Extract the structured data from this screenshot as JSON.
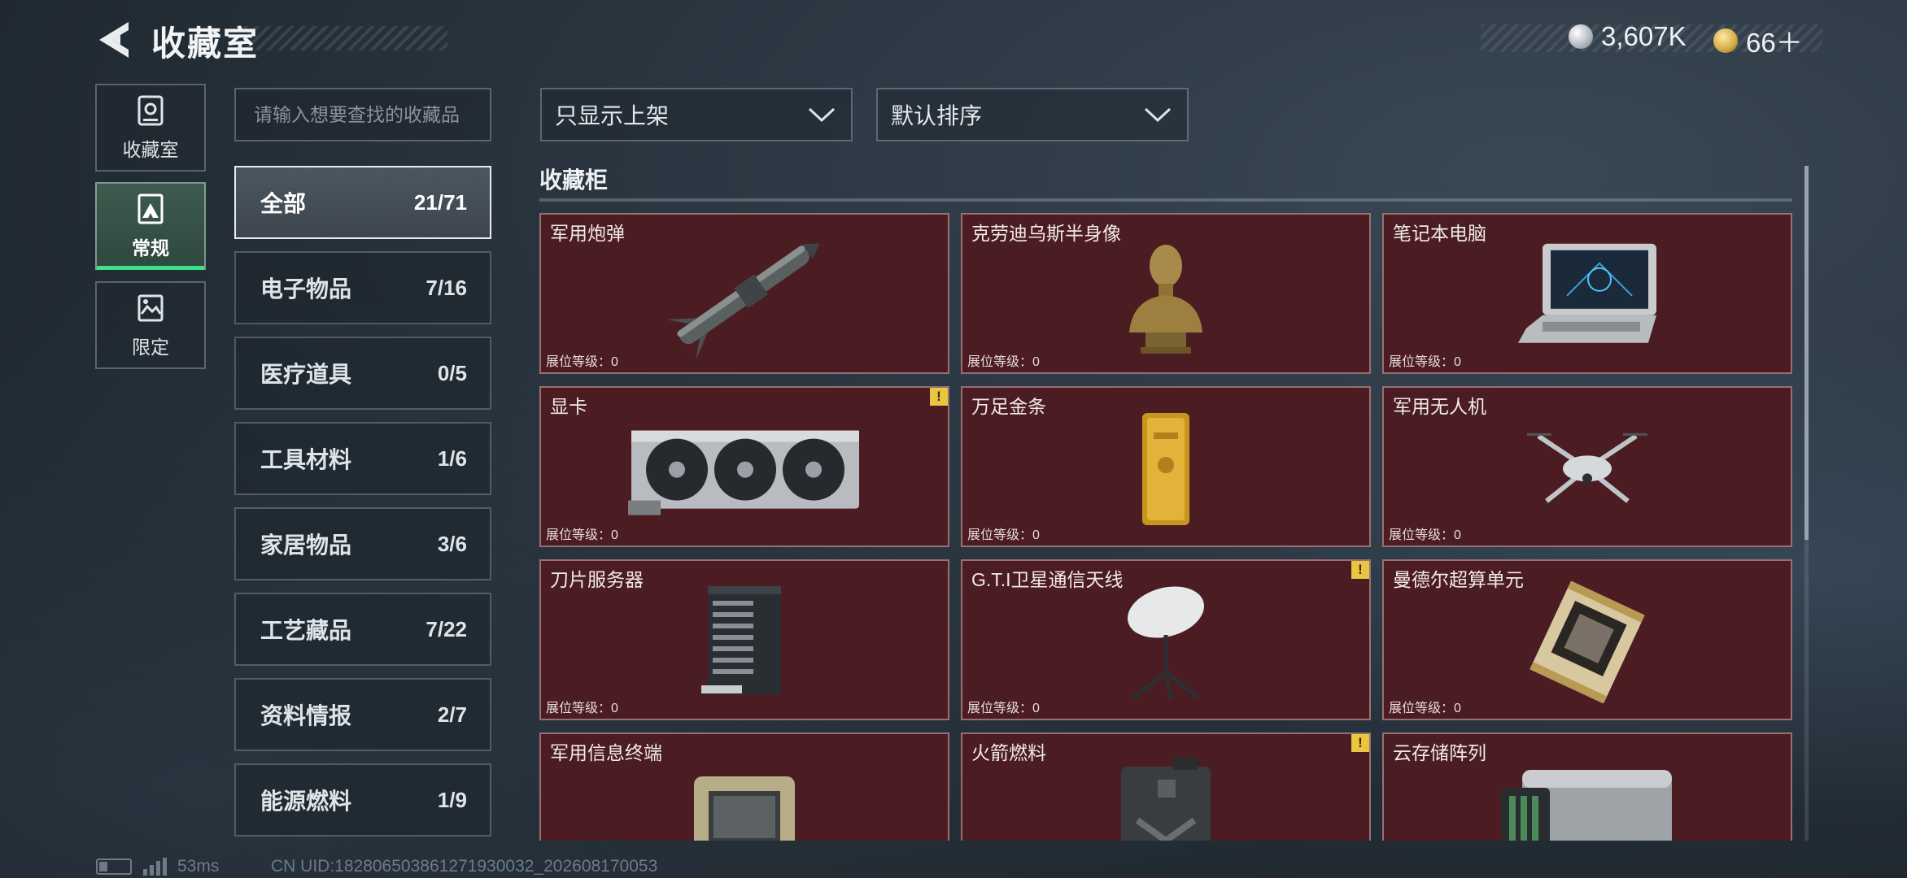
{
  "header": {
    "title": "收藏室",
    "currency": [
      {
        "icon": "silver-coin-icon",
        "value": "3,607K",
        "color": "#c9cfd4"
      },
      {
        "icon": "gold-triangle-coin-icon",
        "value": "66＋",
        "color": "#d8b04a"
      }
    ]
  },
  "left_tabs": [
    {
      "label": "收藏室",
      "icon": "vault-icon"
    },
    {
      "label": "常规",
      "icon": "mountain-card-icon",
      "active": true
    },
    {
      "label": "限定",
      "icon": "landscape-card-icon"
    }
  ],
  "search": {
    "placeholder": "请输入想要查找的收藏品"
  },
  "categories": [
    {
      "label": "全部",
      "count": "21/71",
      "active": true
    },
    {
      "label": "电子物品",
      "count": "7/16"
    },
    {
      "label": "医疗道具",
      "count": "0/5"
    },
    {
      "label": "工具材料",
      "count": "1/6"
    },
    {
      "label": "家居物品",
      "count": "3/6"
    },
    {
      "label": "工艺藏品",
      "count": "7/22"
    },
    {
      "label": "资料情报",
      "count": "2/7"
    },
    {
      "label": "能源燃料",
      "count": "1/9"
    }
  ],
  "filters": {
    "show": "只显示上架",
    "sort": "默认排序"
  },
  "section": {
    "title": "收藏柜"
  },
  "items": [
    {
      "name": "军用炮弹",
      "level": "展位等级：0",
      "warn": false,
      "art": "missile"
    },
    {
      "name": "克劳迪乌斯半身像",
      "level": "展位等级：0",
      "warn": false,
      "art": "bust"
    },
    {
      "name": "笔记本电脑",
      "level": "展位等级：0",
      "warn": false,
      "art": "laptop"
    },
    {
      "name": "显卡",
      "level": "展位等级：0",
      "warn": true,
      "art": "gpu"
    },
    {
      "name": "万足金条",
      "level": "展位等级：0",
      "warn": false,
      "art": "goldbar"
    },
    {
      "name": "军用无人机",
      "level": "展位等级：0",
      "warn": false,
      "art": "drone"
    },
    {
      "name": "刀片服务器",
      "level": "展位等级：0",
      "warn": false,
      "art": "server"
    },
    {
      "name": "G.T.I卫星通信天线",
      "level": "展位等级：0",
      "warn": true,
      "art": "dish"
    },
    {
      "name": "曼德尔超算单元",
      "level": "展位等级：0",
      "warn": false,
      "art": "board"
    },
    {
      "name": "军用信息终端",
      "level": "",
      "warn": false,
      "art": "terminal"
    },
    {
      "name": "火箭燃料",
      "level": "",
      "warn": true,
      "art": "jerrycan"
    },
    {
      "name": "云存储阵列",
      "level": "",
      "warn": false,
      "art": "storage"
    }
  ],
  "footer": {
    "ping": "53ms",
    "uid": "CN UID:182806503861271930032_202608170053"
  }
}
